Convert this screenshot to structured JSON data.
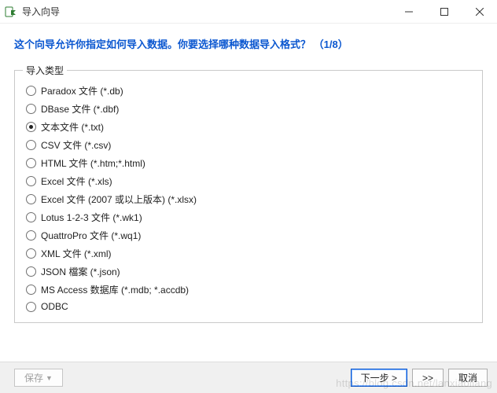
{
  "window": {
    "title": "导入向导"
  },
  "header": {
    "prompt": "这个向导允许你指定如何导入数据。你要选择哪种数据导入格式？",
    "step": "（1/8）"
  },
  "group": {
    "label": "导入类型",
    "selected_index": 2,
    "options": [
      "Paradox 文件 (*.db)",
      "DBase 文件 (*.dbf)",
      "文本文件 (*.txt)",
      "CSV 文件 (*.csv)",
      "HTML 文件 (*.htm;*.html)",
      "Excel 文件 (*.xls)",
      "Excel 文件 (2007 或以上版本) (*.xlsx)",
      "Lotus 1-2-3 文件 (*.wk1)",
      "QuattroPro 文件 (*.wq1)",
      "XML 文件 (*.xml)",
      "JSON 檔案 (*.json)",
      "MS Access 数据库 (*.mdb; *.accdb)",
      "ODBC"
    ]
  },
  "footer": {
    "save_label": "保存",
    "next_label": "下一步 >",
    "overflow_label": ">>",
    "cancel_label": "取消"
  },
  "watermark": "https://blog.csdn.net/lanxiaoliang"
}
